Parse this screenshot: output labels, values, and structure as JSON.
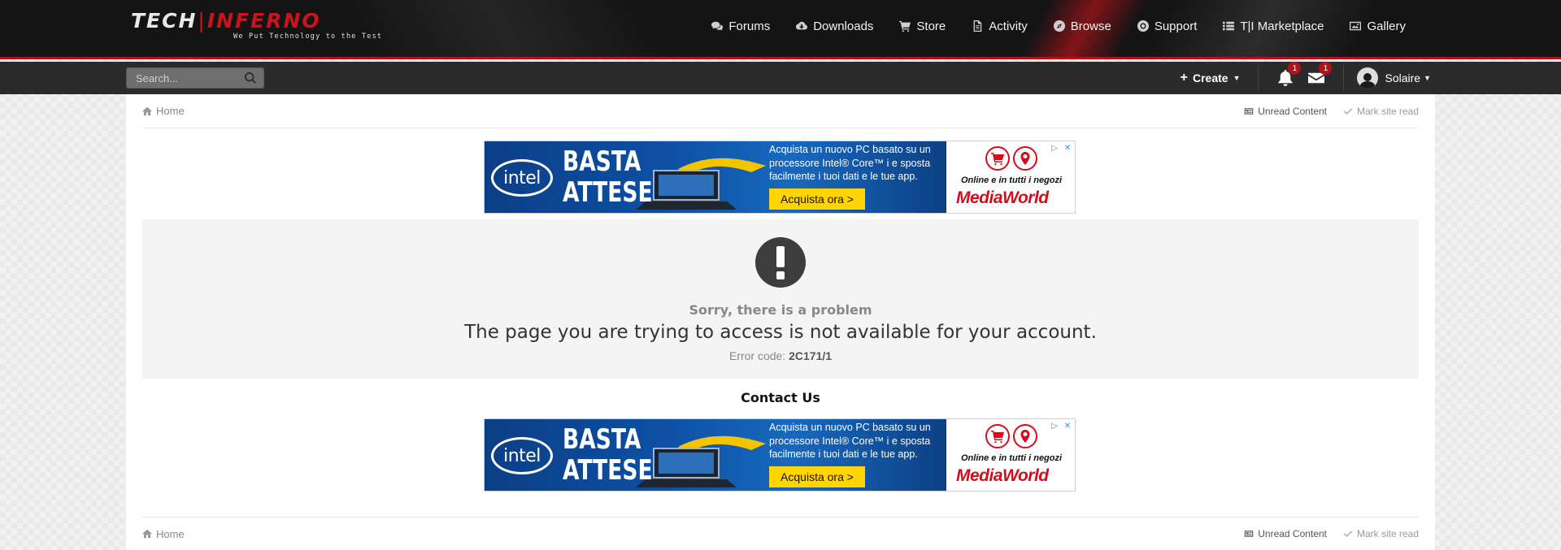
{
  "logo": {
    "tech": "TECH",
    "inferno": "INFERNO",
    "tagline": "We Put Technology to the Test"
  },
  "nav": [
    {
      "label": "Forums",
      "icon": "chat-bubbles-icon"
    },
    {
      "label": "Downloads",
      "icon": "cloud-download-icon"
    },
    {
      "label": "Store",
      "icon": "shopping-cart-icon"
    },
    {
      "label": "Activity",
      "icon": "document-icon"
    },
    {
      "label": "Browse",
      "icon": "compass-icon"
    },
    {
      "label": "Support",
      "icon": "lifebuoy-icon"
    },
    {
      "label": "T|I Marketplace",
      "icon": "list-icon"
    },
    {
      "label": "Gallery",
      "icon": "image-icon"
    }
  ],
  "search": {
    "placeholder": "Search..."
  },
  "userbar": {
    "create_label": "Create",
    "notifications_count": "1",
    "messages_count": "1",
    "username": "Solaire"
  },
  "breadcrumb": {
    "home": "Home",
    "unread": "Unread Content",
    "mark_read": "Mark site read"
  },
  "ad": {
    "brand_left": "intel",
    "headline_1": "BASTA",
    "headline_2": "ATTESE",
    "text": "Acquista un nuovo PC basato su un processore Intel® Core™ i e sposta facilmente i tuoi dati e le tue app.",
    "cta": "Acquista ora >",
    "store_tagline": "Online e in tutti i negozi",
    "store_brand": "MediaWorld"
  },
  "error": {
    "subtitle": "Sorry, there is a problem",
    "message": "The page you are trying to access is not available for your account.",
    "code_label": "Error code:",
    "code": "2C171/1"
  },
  "contact_label": "Contact Us",
  "colors": {
    "accent": "#b3121a",
    "header": "#141414",
    "subbar": "#2b2b2b"
  }
}
